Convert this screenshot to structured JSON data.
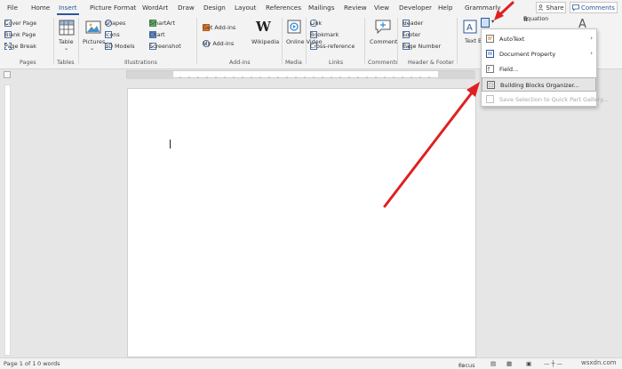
{
  "tabs": [
    {
      "label": "File",
      "active": false
    },
    {
      "label": "Home",
      "active": false
    },
    {
      "label": "Insert",
      "active": true
    },
    {
      "label": "Picture Format",
      "active": false
    },
    {
      "label": "WordArt",
      "active": false
    },
    {
      "label": "Draw",
      "active": false
    },
    {
      "label": "Design",
      "active": false
    },
    {
      "label": "Layout",
      "active": false
    },
    {
      "label": "References",
      "active": false
    },
    {
      "label": "Mailings",
      "active": false
    },
    {
      "label": "Review",
      "active": false
    },
    {
      "label": "View",
      "active": false
    },
    {
      "label": "Developer",
      "active": false
    },
    {
      "label": "Help",
      "active": false
    },
    {
      "label": "Grammarly",
      "active": false
    }
  ],
  "share_label": "Share",
  "comments_label": "Comments",
  "groups": {
    "pages": {
      "label": "Pages",
      "items": [
        "Cover Page",
        "Blank Page",
        "Page Break"
      ]
    },
    "tables": {
      "label": "Tables",
      "table": "Table"
    },
    "illustrations": {
      "label": "Illustrations",
      "pictures": "Pictures",
      "shapes": "Shapes",
      "icons": "Icons",
      "models": "3D Models",
      "smartart": "SmartArt",
      "chart": "Chart",
      "screenshot": "Screenshot"
    },
    "addins": {
      "label": "Add-ins",
      "get": "Get Add-ins",
      "my": "My Add-ins",
      "wikipedia": "Wikipedia"
    },
    "media": {
      "label": "Media",
      "online_video": "Online Video"
    },
    "links": {
      "label": "Links",
      "link": "Link",
      "bookmark": "Bookmark",
      "cross": "Cross-reference"
    },
    "comments": {
      "label": "Comments",
      "comment": "Comment"
    },
    "header_footer": {
      "label": "Header & Footer",
      "header": "Header",
      "footer": "Footer",
      "page_number": "Page Number"
    },
    "text": {
      "textbox": "Text Box",
      "equation": "Equation"
    }
  },
  "dropdown": {
    "items": [
      {
        "label": "AutoText",
        "submenu": true,
        "highlighted": false,
        "disabled": false
      },
      {
        "label": "Document Property",
        "submenu": true,
        "highlighted": false,
        "disabled": false
      },
      {
        "label": "Field...",
        "submenu": false,
        "highlighted": false,
        "disabled": false
      },
      {
        "label": "Building Blocks Organizer...",
        "submenu": false,
        "highlighted": true,
        "disabled": false
      },
      {
        "label": "Save Selection to Quick Part Gallery...",
        "submenu": false,
        "highlighted": false,
        "disabled": true
      }
    ]
  },
  "status": {
    "page": "Page 1 of 1",
    "words": "0 words",
    "focus": "Focus"
  },
  "watermark": "wsxdn.com",
  "colors": {
    "accent": "#2b579a",
    "arrow": "#e02020"
  }
}
